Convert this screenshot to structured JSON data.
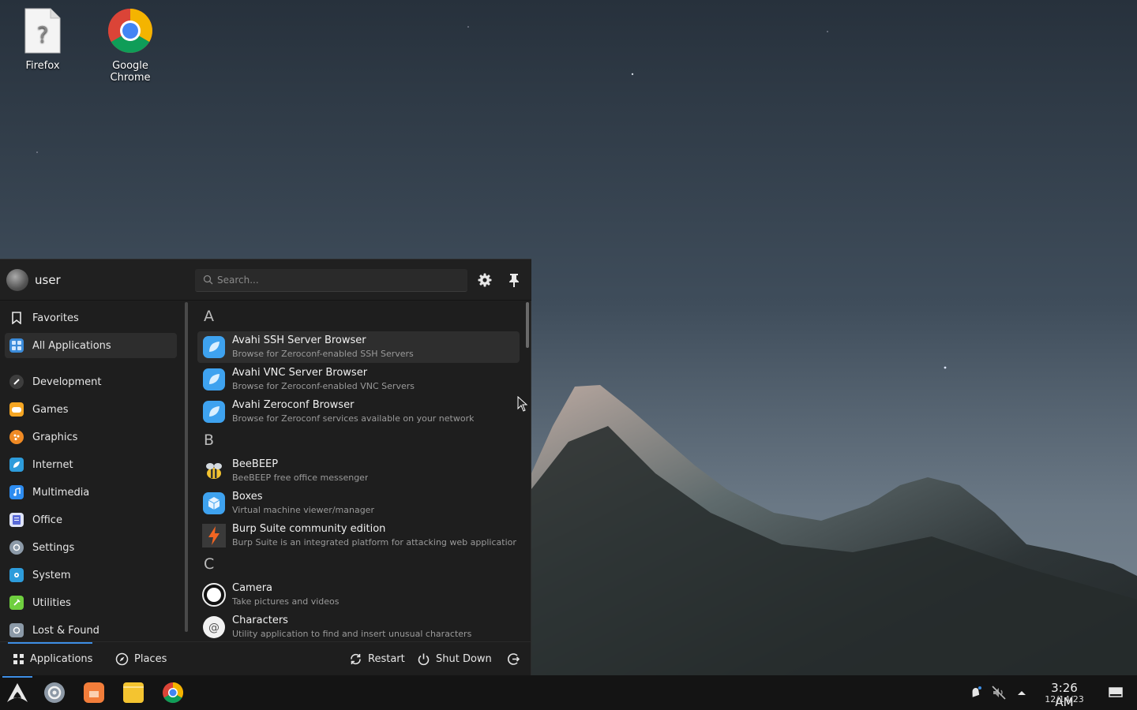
{
  "desktop": {
    "icons": [
      {
        "label": "Firefox",
        "icon": "unknown-file-icon"
      },
      {
        "label": "Google Chrome",
        "icon": "chrome-icon"
      }
    ]
  },
  "menu": {
    "user": {
      "name": "user"
    },
    "search": {
      "placeholder": "Search..."
    },
    "categories": [
      {
        "label": "Favorites",
        "icon": "bookmark-icon"
      },
      {
        "label": "All Applications",
        "icon": "grid-icon",
        "active": true
      },
      {
        "label": "Development",
        "icon": "development-icon"
      },
      {
        "label": "Games",
        "icon": "games-icon"
      },
      {
        "label": "Graphics",
        "icon": "graphics-icon"
      },
      {
        "label": "Internet",
        "icon": "internet-icon"
      },
      {
        "label": "Multimedia",
        "icon": "multimedia-icon"
      },
      {
        "label": "Office",
        "icon": "office-icon"
      },
      {
        "label": "Settings",
        "icon": "settings-icon"
      },
      {
        "label": "System",
        "icon": "system-icon"
      },
      {
        "label": "Utilities",
        "icon": "utilities-icon"
      },
      {
        "label": "Lost & Found",
        "icon": "lost-found-icon"
      }
    ],
    "sections": [
      {
        "letter": "A",
        "apps": [
          {
            "name": "Avahi SSH Server Browser",
            "desc": "Browse for Zeroconf-enabled SSH Servers",
            "icon": "avahi-icon"
          },
          {
            "name": "Avahi VNC Server Browser",
            "desc": "Browse for Zeroconf-enabled VNC Servers",
            "icon": "avahi-icon"
          },
          {
            "name": "Avahi Zeroconf Browser",
            "desc": "Browse for Zeroconf services available on your network",
            "icon": "avahi-icon"
          }
        ]
      },
      {
        "letter": "B",
        "apps": [
          {
            "name": "BeeBEEP",
            "desc": "BeeBEEP free office messenger",
            "icon": "bee-icon"
          },
          {
            "name": "Boxes",
            "desc": "Virtual machine viewer/manager",
            "icon": "boxes-icon"
          },
          {
            "name": "Burp Suite community edition",
            "desc": "Burp Suite is an integrated platform for attacking web applications ...",
            "icon": "burp-icon"
          }
        ]
      },
      {
        "letter": "C",
        "apps": [
          {
            "name": "Camera",
            "desc": "Take pictures and videos",
            "icon": "camera-icon"
          },
          {
            "name": "Characters",
            "desc": "Utility application to find and insert unusual characters",
            "icon": "characters-icon"
          }
        ]
      }
    ],
    "footer": {
      "applications": "Applications",
      "places": "Places",
      "restart": "Restart",
      "shutdown": "Shut Down"
    }
  },
  "taskbar": {
    "clock": {
      "time": "3:26 AM",
      "date": "12/14/23"
    }
  },
  "colors": {
    "accent": "#3d8ee5",
    "menu_bg": "#1e1e1e",
    "taskbar_bg": "#141414"
  }
}
